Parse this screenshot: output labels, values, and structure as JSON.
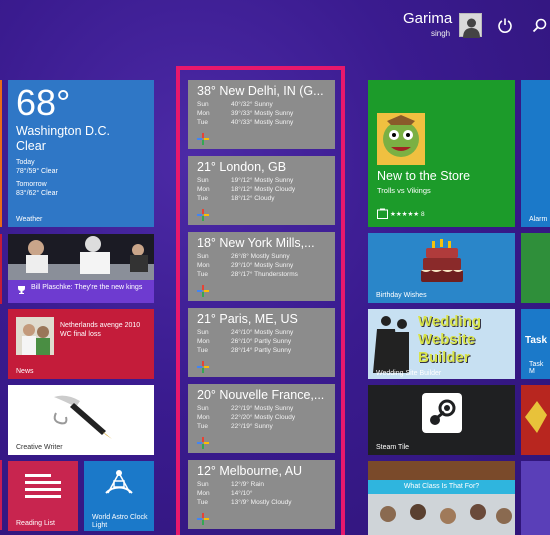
{
  "user": {
    "name": "Garima",
    "subname": "singh"
  },
  "weather_tiles": [
    {
      "city": "38° New Delhi, IN (G...",
      "rows": [
        [
          "Sun",
          "40°/32° Sunny"
        ],
        [
          "Mon",
          "39°/33° Mostly Sunny"
        ],
        [
          "Tue",
          "40°/33° Mostly Sunny"
        ]
      ]
    },
    {
      "city": "21° London, GB",
      "rows": [
        [
          "Sun",
          "19°/12° Mostly Sunny"
        ],
        [
          "Mon",
          "18°/12° Mostly Cloudy"
        ],
        [
          "Tue",
          "18°/12° Cloudy"
        ]
      ]
    },
    {
      "city": "18° New York Mills,...",
      "rows": [
        [
          "Sun",
          "26°/8° Mostly Sunny"
        ],
        [
          "Mon",
          "29°/10° Mostly Sunny"
        ],
        [
          "Tue",
          "28°/17° Thunderstorms"
        ]
      ]
    },
    {
      "city": "21° Paris, ME, US",
      "rows": [
        [
          "Sun",
          "24°/10° Mostly Sunny"
        ],
        [
          "Mon",
          "26°/10° Partly Sunny"
        ],
        [
          "Tue",
          "28°/14° Partly Sunny"
        ]
      ]
    },
    {
      "city": "20° Nouvelle France,...",
      "rows": [
        [
          "Sun",
          "22°/19° Mostly Sunny"
        ],
        [
          "Mon",
          "22°/20° Mostly Cloudy"
        ],
        [
          "Tue",
          "22°/19° Sunny"
        ]
      ]
    },
    {
      "city": "12° Melbourne, AU",
      "rows": [
        [
          "Sun",
          "12°/9° Rain"
        ],
        [
          "Mon",
          "14°/10°"
        ],
        [
          "Tue",
          "13°/9° Mostly Cloudy"
        ]
      ]
    }
  ],
  "washington": {
    "temp": "68°",
    "city": "Washington D.C.",
    "condition": "Clear",
    "today_label": "Today",
    "today": "78°/59° Clear",
    "tomorrow_label": "Tomorrow",
    "tomorrow": "83°/62° Clear",
    "label": "Weather"
  },
  "news": {
    "headline": "Bill Plaschke: They're the new kings"
  },
  "sport": {
    "headline": "Netherlands avenge 2010 WC final loss",
    "label": "News"
  },
  "creative": {
    "label": "Creative Writer"
  },
  "reading": {
    "label": "Reading List"
  },
  "astro": {
    "label": "World Astro Clock Light"
  },
  "store": {
    "title": "New to the Store",
    "app": "Trolls vs Vikings",
    "rating": "★★★★★ 8"
  },
  "birthday": {
    "label": "Birthday Wishes"
  },
  "wedding": {
    "line1": "Wedding",
    "line2": "Website",
    "line3": "Builder",
    "label": "Wedding Site Builder"
  },
  "steam": {
    "label": "Steam Tile"
  },
  "class": {
    "label": "What Class Is That For?"
  },
  "alarm": {
    "label": "Alarm"
  },
  "task": {
    "title": "Task",
    "label": "Task M"
  },
  "colors": {
    "pink": "#e8186c",
    "store_green": "#1c9b2a",
    "weather_blue": "#2f77c6",
    "bg": "#3a1b8f"
  }
}
